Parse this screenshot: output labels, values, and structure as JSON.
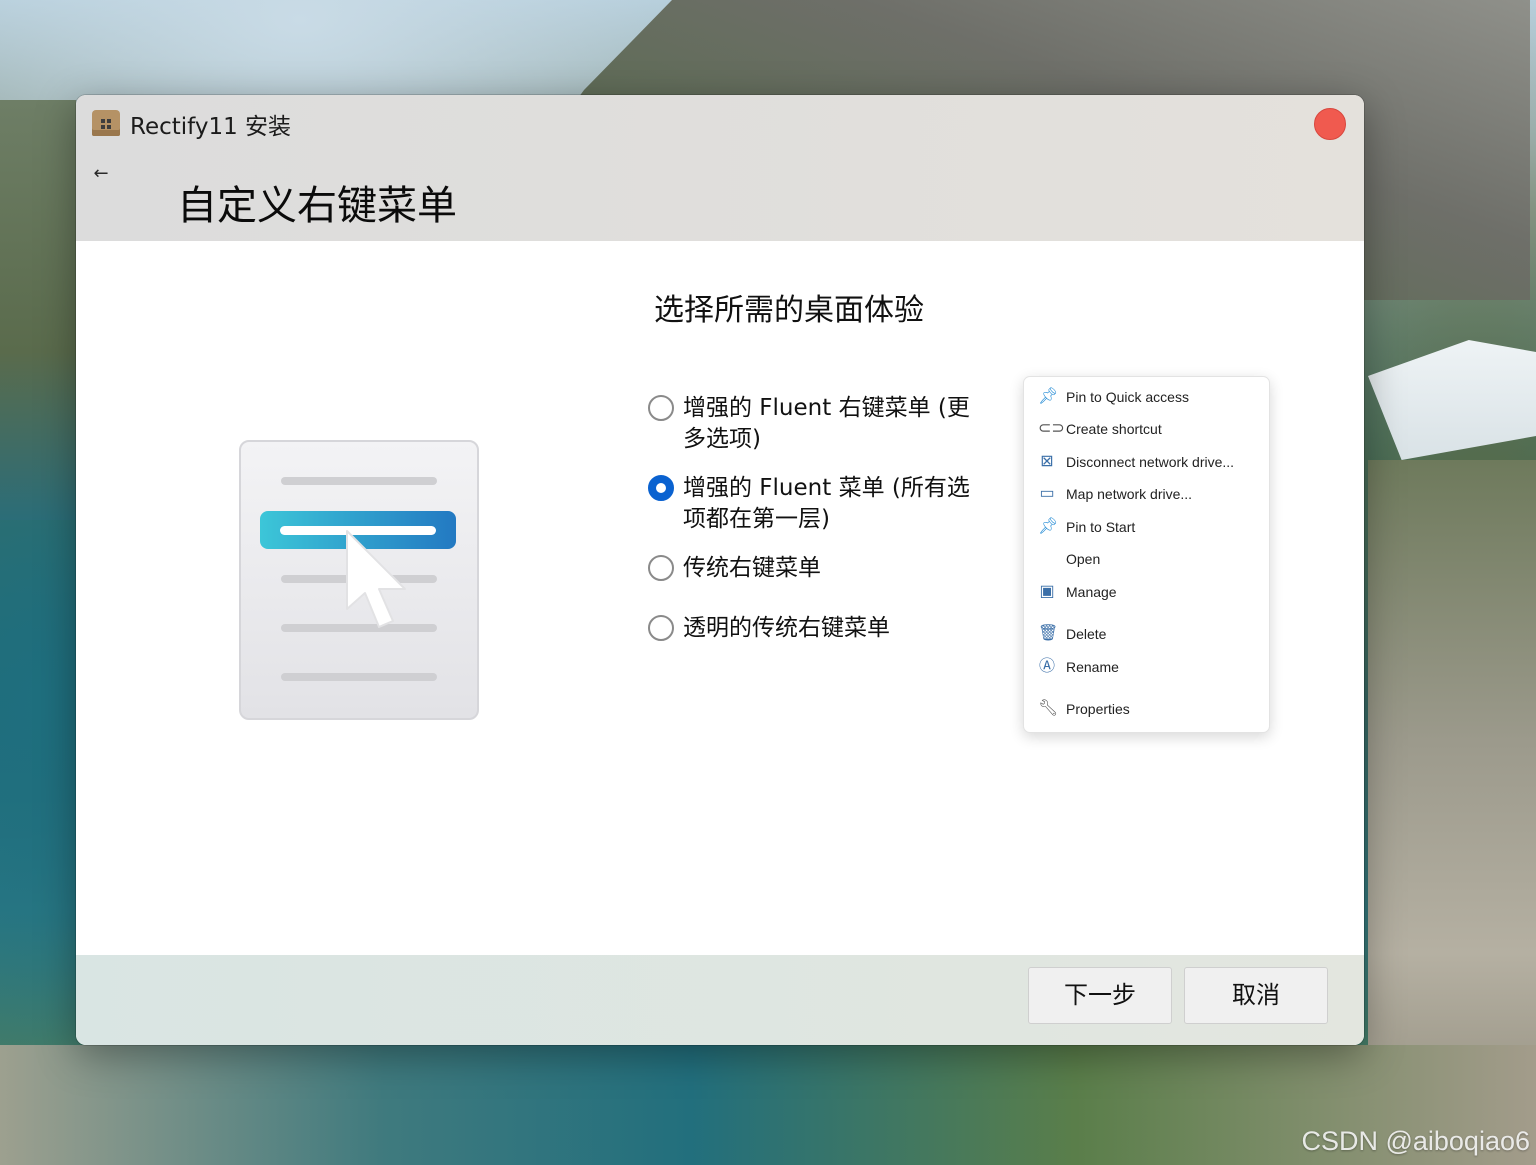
{
  "window": {
    "app_title": "Rectify11 安装",
    "page_title": "自定义右键菜单"
  },
  "main": {
    "heading": "选择所需的桌面体验",
    "options": [
      {
        "label": "增强的 Fluent 右键菜单 (更多选项)",
        "selected": false
      },
      {
        "label": "增强的 Fluent 菜单 (所有选项都在第一层)",
        "selected": true
      },
      {
        "label": "传统右键菜单",
        "selected": false
      },
      {
        "label": "透明的传统右键菜单",
        "selected": false
      }
    ]
  },
  "context_menu_preview": {
    "items": [
      {
        "label": "Pin to Quick access",
        "icon": "pin-icon"
      },
      {
        "label": "Create shortcut",
        "icon": "link-icon"
      },
      {
        "label": "Disconnect network drive...",
        "icon": "network-disconnect-icon"
      },
      {
        "label": "Map network drive...",
        "icon": "network-drive-icon"
      },
      {
        "label": "Pin to Start",
        "icon": "pin-icon"
      },
      {
        "label": "Open",
        "icon": ""
      },
      {
        "label": "Manage",
        "icon": "computer-manage-icon"
      },
      {
        "label": "Delete",
        "icon": "trash-icon"
      },
      {
        "label": "Rename",
        "icon": "rename-icon"
      },
      {
        "label": "Properties",
        "icon": "wrench-icon"
      }
    ]
  },
  "footer": {
    "next_label": "下一步",
    "cancel_label": "取消"
  },
  "watermark": "CSDN @aiboqiao6",
  "colors": {
    "accent": "#0a62d0",
    "close_button": "#f05a4f",
    "highlight_start": "#3cc6d8",
    "highlight_end": "#2379c2"
  }
}
